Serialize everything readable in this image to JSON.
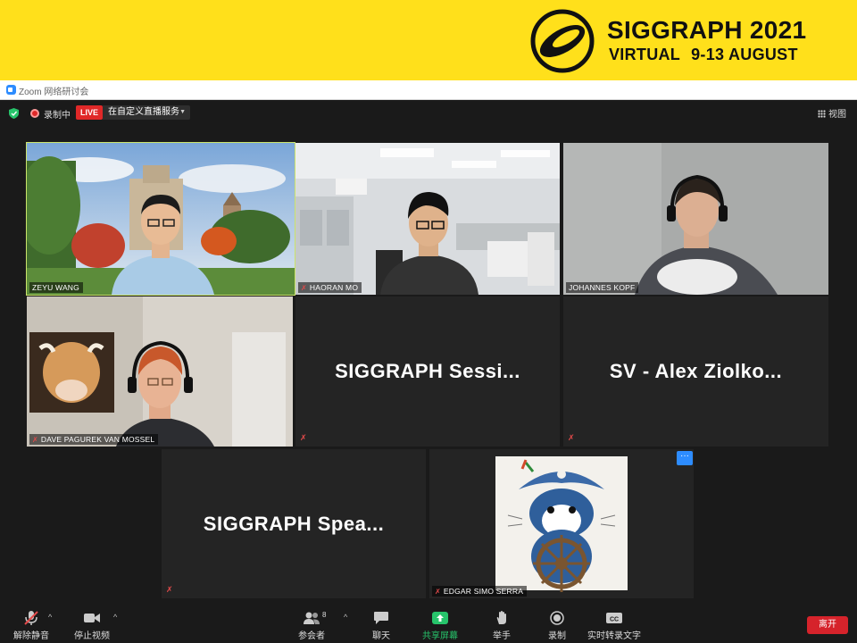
{
  "banner": {
    "title": "SIGGRAPH 2021",
    "subtitle_left": "VIRTUAL",
    "subtitle_right": "9-13 AUGUST"
  },
  "window": {
    "title": "Zoom 网络研讨会"
  },
  "topbar": {
    "recording_label": "录制中",
    "live_badge": "LIVE",
    "live_service": "在自定义直播服务",
    "view_label": "视图"
  },
  "participants": [
    {
      "name": "ZEYU WANG"
    },
    {
      "name": "HAORAN MO"
    },
    {
      "name": "JOHANNES KOPF"
    },
    {
      "name": "DAVE PAGUREK VAN MOSSEL"
    },
    {
      "placeholder": "SIGGRAPH  Sessi..."
    },
    {
      "placeholder": "SV  -  Alex Ziolko..."
    },
    {
      "placeholder": "SIGGRAPH  Spea..."
    },
    {
      "name": "EDGAR SIMO SERRA",
      "more": "···"
    }
  ],
  "toolbar": {
    "unmute": "解除静音",
    "stop_video": "停止视频",
    "participants": "参会者",
    "participant_count": "8",
    "chat": "聊天",
    "share_screen": "共享屏幕",
    "raise_hand": "举手",
    "record": "录制",
    "transcript": "实时转录文字",
    "leave": "离开"
  },
  "colors": {
    "banner": "#ffe01b",
    "active_speaker": "#cbe36b",
    "live": "#e02828",
    "share": "#27c46b",
    "leave": "#d6232b",
    "accent": "#2d8cff"
  }
}
